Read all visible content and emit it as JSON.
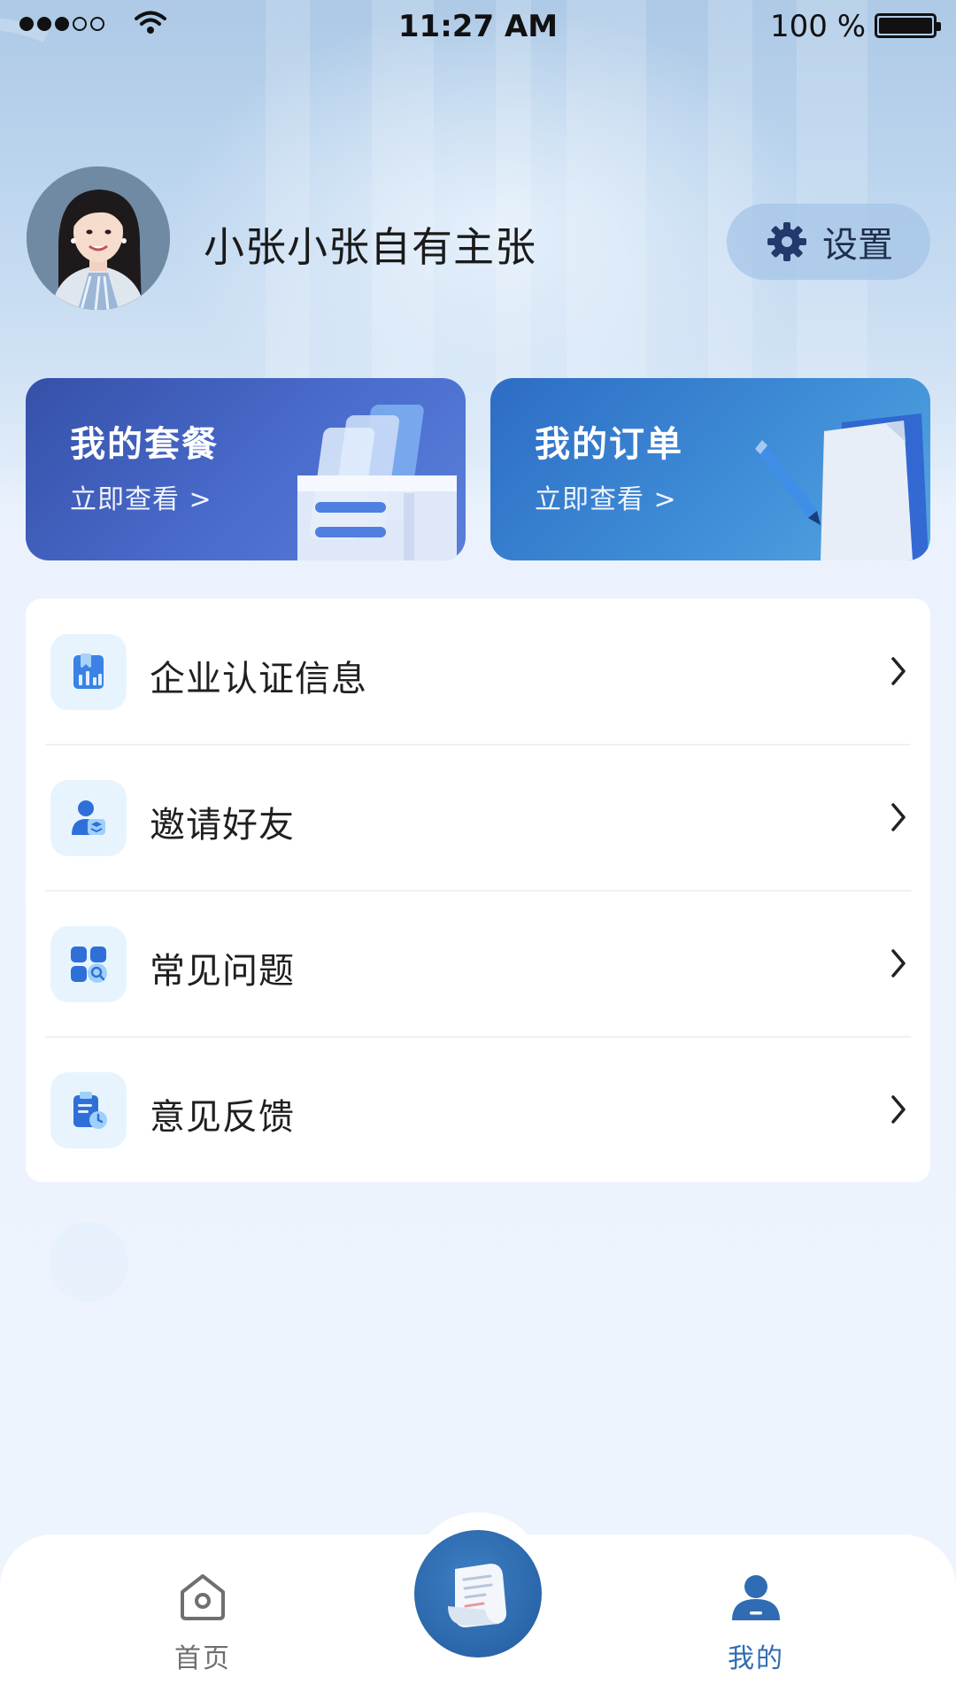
{
  "status_bar": {
    "time": "11:27 AM",
    "battery": "100 %",
    "signal_icon": "signal-dots-icon",
    "wifi_icon": "wifi-icon",
    "battery_icon": "battery-icon"
  },
  "profile": {
    "username": "小张小张自有主张",
    "avatar_icon": "avatar",
    "settings_label": "设置",
    "settings_icon": "gear-icon"
  },
  "cards": [
    {
      "title": "我的套餐",
      "link": "立即查看 >",
      "icon": "package-tray-icon"
    },
    {
      "title": "我的订单",
      "link": "立即查看 >",
      "icon": "order-document-icon"
    }
  ],
  "menu": {
    "items": [
      {
        "label": "企业认证信息",
        "icon": "enterprise-certificate-icon"
      },
      {
        "label": "邀请好友",
        "icon": "invite-user-icon"
      },
      {
        "label": "常见问题",
        "icon": "faq-search-icon"
      },
      {
        "label": "意见反馈",
        "icon": "feedback-clipboard-icon"
      }
    ]
  },
  "tab_bar": {
    "home_label": "首页",
    "mine_label": "我的",
    "center_icon": "document-scroll-icon",
    "active_tab": "我的"
  },
  "colors": {
    "accent": "#2f6cb4",
    "card_package": "#3f5ebf",
    "card_orders": "#3a86d3",
    "background": "#eaf2fd"
  }
}
